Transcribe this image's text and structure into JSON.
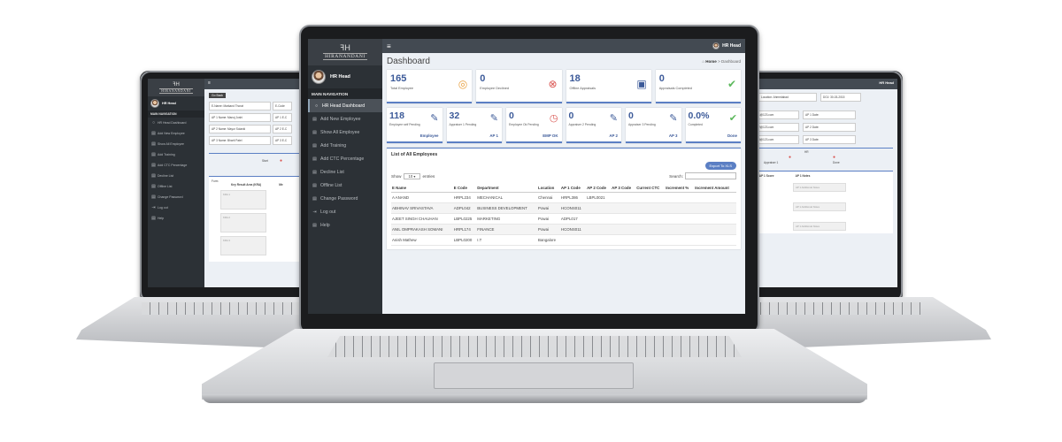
{
  "brand": {
    "name": "HIRANANDANI",
    "mark": "ꟻH"
  },
  "user": {
    "name": "HR Head"
  },
  "sidebar": {
    "heading": "MAIN NAVIGATION",
    "items": [
      {
        "label": "HR Head Dashboard",
        "icon": "circle-icon",
        "active": true
      },
      {
        "label": "Add New Employee",
        "icon": "list-icon"
      },
      {
        "label": "Show All Employee",
        "icon": "list-icon"
      },
      {
        "label": "Add Training",
        "icon": "list-icon"
      },
      {
        "label": "Add CTC Percentage",
        "icon": "list-icon"
      },
      {
        "label": "Decline List",
        "icon": "list-icon"
      },
      {
        "label": "Offline List",
        "icon": "list-icon"
      },
      {
        "label": "Change Password",
        "icon": "list-icon"
      },
      {
        "label": "Log out",
        "icon": "logout-icon"
      },
      {
        "label": "Help",
        "icon": "list-icon"
      }
    ]
  },
  "header": {
    "hamburger": "≡",
    "user": "HR Head"
  },
  "page": {
    "title": "Dashboard",
    "breadcrumb_home": "Home",
    "breadcrumb_sep": ">",
    "breadcrumb_current": "Dashboard"
  },
  "stats_top": [
    {
      "value": "165",
      "label": "Total Employee",
      "icon": "target-icon",
      "color": "#e8a040"
    },
    {
      "value": "0",
      "label": "Employee Declined",
      "icon": "x-circle-icon",
      "color": "#d9534f"
    },
    {
      "value": "18",
      "label": "Offline Appraisals",
      "icon": "document-icon",
      "color": "#3c5a99"
    },
    {
      "value": "0",
      "label": "Appraisals Completed",
      "icon": "check-circle-icon",
      "color": "#5cb85c"
    }
  ],
  "stats_bottom": [
    {
      "value": "118",
      "label": "Employee self Pending",
      "link": "Employee",
      "icon": "edit-icon",
      "color": "#3c5a99"
    },
    {
      "value": "32",
      "label": "Appraiser 1 Pending",
      "link": "AP 1",
      "icon": "edit-icon",
      "color": "#3c5a99"
    },
    {
      "value": "0",
      "label": "Employee Ok Pending",
      "link": "EMP OK",
      "icon": "clock-icon",
      "color": "#d9534f"
    },
    {
      "value": "0",
      "label": "Appraiser 2 Pending",
      "link": "AP 2",
      "icon": "edit-icon",
      "color": "#3c5a99"
    },
    {
      "value": "0",
      "label": "Appraiser 3 Pending",
      "link": "AP 3",
      "icon": "edit-icon",
      "color": "#3c5a99"
    },
    {
      "value": "0.0%",
      "label": "Completed",
      "link": "Done",
      "icon": "check-circle-icon",
      "color": "#5cb85c"
    }
  ],
  "employees": {
    "title": "List of All Employees",
    "export_label": "Export To XLS",
    "show_label": "Show",
    "entries_value": "10",
    "entries_label": "entries",
    "search_label": "Search:",
    "columns": [
      "E Name",
      "E Code",
      "Department",
      "Location",
      "AP 1 Code",
      "AP 2 Code",
      "AP 3 Code",
      "Current CTC",
      "Increment %",
      "Increment Amount"
    ],
    "rows": [
      [
        "A ANAND",
        "HRPL234",
        "MECHANICAL",
        "Chennai",
        "HRPL386",
        "LBPL0021",
        "",
        "",
        "",
        ""
      ],
      [
        "ABHINAV SRIVASTAVA",
        "ADPL042",
        "BUSINESS DEVELOPMENT",
        "Powai",
        "HCONS011",
        "",
        "",
        "",
        "",
        ""
      ],
      [
        "AJEET SINGH CHAUHAN",
        "LBPL0225",
        "MARKETING",
        "Powai",
        "ADPL017",
        "",
        "",
        "",
        "",
        ""
      ],
      [
        "ANIL OMPRAKASH SOMANI",
        "HRPL174",
        "FINANCE",
        "Powai",
        "HCONS011",
        "",
        "",
        "",
        "",
        ""
      ],
      [
        "Anish Mathew",
        "LBPL0200",
        "I.T",
        "Bangalore",
        "",
        "",
        "",
        "",
        "",
        ""
      ]
    ]
  },
  "left_screen": {
    "back_button": "Go Back",
    "fields": [
      "E-Name: Markand Thorat",
      "E-Code",
      "AP 1 Name: Manoj Joshi",
      "AP 1 E-C",
      "AP 2 Name: Mayur Solanki",
      "AP 2 E-C",
      "AP 3 Name: Bharti Patel",
      "AP 3 E-C"
    ],
    "step_label": "Start",
    "form_label": "Form",
    "kra_header": "Key Result Area (KRA)",
    "kra_header2": "Me",
    "kra_items": [
      "KRA 1",
      "KRA 2",
      "KRA 3"
    ]
  },
  "right_screen": {
    "fields": [
      "T",
      "Location: Ahmedabad",
      "DOJ: 30-03-2015",
      "AP 1 Email: ap1@123.com",
      "AP 1 Date:",
      "AP 2 Email: ap2@123.com",
      "AP 2 Date:",
      "AP 3 Email: ap3@123.com",
      "AP 3 Date:"
    ],
    "step_label1": "Appraiser 1",
    "step_label2": "HR",
    "step_label3": "Done",
    "score_header1": "nting",
    "score_header2": "AP 1 Score",
    "score_header3": "AP 1 Notes",
    "notes": [
      "AP 1 Additional Notes",
      "AP 1 Additional Notes",
      "AP 1 Additional Notes"
    ]
  }
}
